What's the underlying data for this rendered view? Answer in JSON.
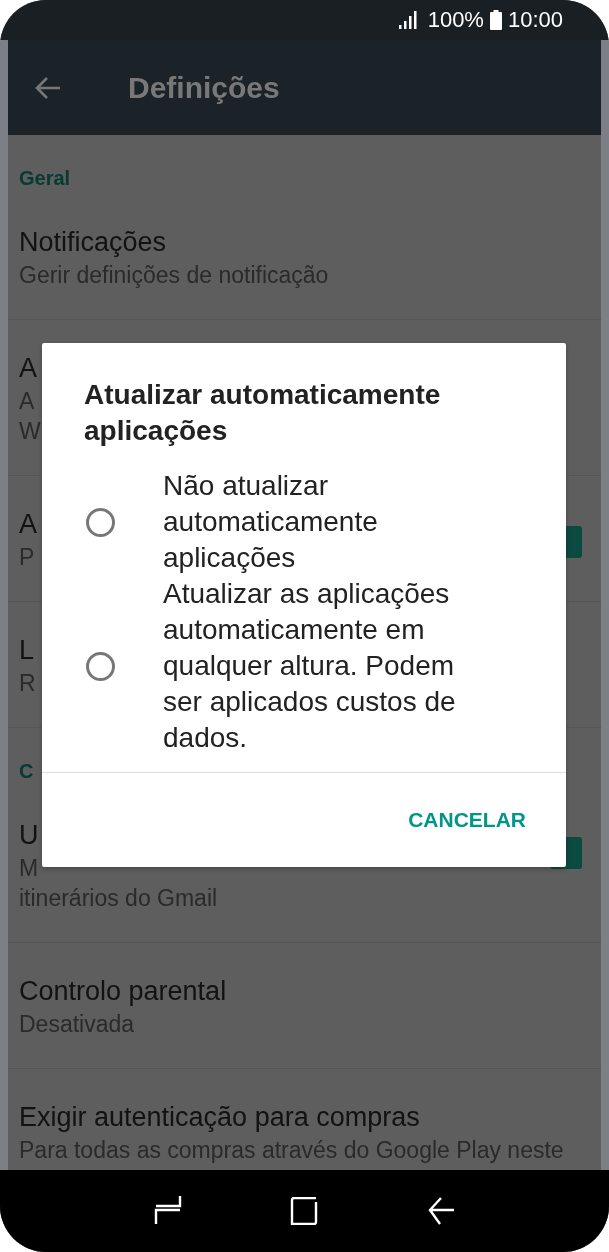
{
  "status_bar": {
    "battery": "100%",
    "time": "10:00"
  },
  "app_bar": {
    "title": "Definições"
  },
  "settings": [
    {
      "kind": "header",
      "title": "Geral"
    },
    {
      "kind": "row",
      "title": "Notificações",
      "subtitle": [
        "Gerir definições de notificação"
      ]
    },
    {
      "kind": "row",
      "title": "A",
      "subtitle": [
        "A",
        "W"
      ]
    },
    {
      "kind": "checkbox",
      "title": "A",
      "subtitle": [
        "P"
      ],
      "checked": true
    },
    {
      "kind": "row",
      "title": "L",
      "subtitle": [
        "R"
      ]
    },
    {
      "kind": "header",
      "title": "C"
    },
    {
      "kind": "checkbox",
      "title": "U",
      "subtitle": [
        "M",
        "itinerários do Gmail"
      ],
      "checked": true
    },
    {
      "kind": "row",
      "title": "Controlo parental",
      "subtitle": [
        "Desativada"
      ]
    },
    {
      "kind": "row",
      "title": "Exigir autenticação para compras",
      "subtitle": [
        "Para todas as compras através do Google Play neste"
      ]
    }
  ],
  "dialog": {
    "title": "Atualizar automaticamente aplicações",
    "options": [
      {
        "label": "Não atualizar automaticamente aplicações",
        "selected": false
      },
      {
        "label": "Atualizar as aplicações automaticamente em qualquer altura. Podem ser aplicados custos de dados.",
        "selected": false
      }
    ],
    "button": "CANCELAR"
  }
}
